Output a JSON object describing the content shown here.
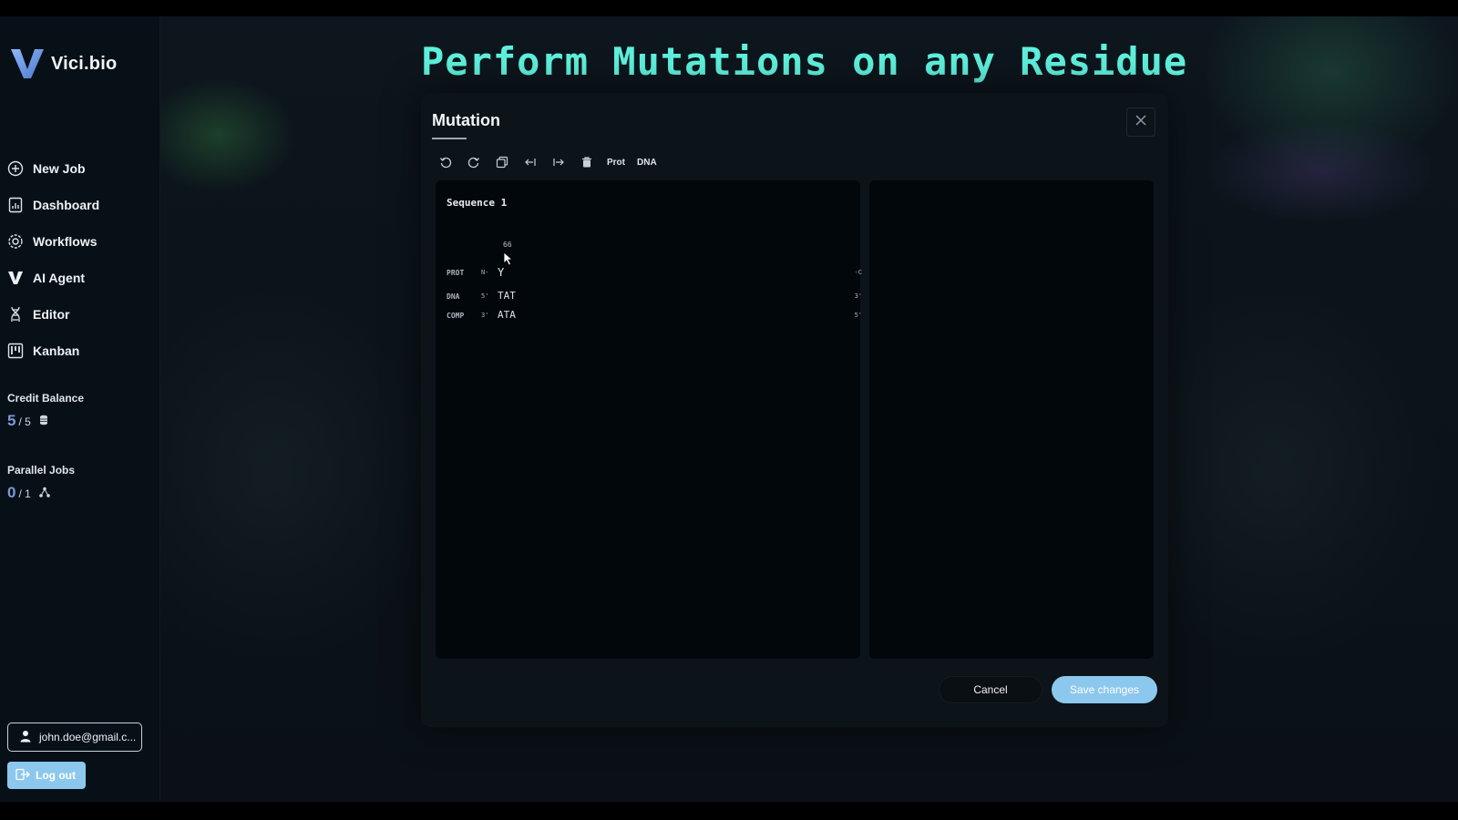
{
  "brand": {
    "name": "Vici.bio",
    "logo_icon": "v-logo-icon"
  },
  "headline": "Perform Mutations on any Residue",
  "sidebar": {
    "items": [
      {
        "label": "New Job",
        "icon": "plus-circle-icon"
      },
      {
        "label": "Dashboard",
        "icon": "chart-doc-icon"
      },
      {
        "label": "Workflows",
        "icon": "workflow-gear-icon"
      },
      {
        "label": "AI Agent",
        "icon": "v-agent-icon"
      },
      {
        "label": "Editor",
        "icon": "dna-helix-icon"
      },
      {
        "label": "Kanban",
        "icon": "kanban-board-icon"
      }
    ],
    "credit": {
      "label": "Credit Balance",
      "value": "5",
      "total": "/ 5",
      "icon": "coin-stack-icon"
    },
    "parallel": {
      "label": "Parallel Jobs",
      "value": "0",
      "total": "/ 1",
      "icon": "network-icon"
    },
    "user_email": "john.doe@gmail.c...",
    "logout_label": "Log out"
  },
  "modal": {
    "title": "Mutation",
    "toolbar": {
      "icons": [
        "undo-icon",
        "redo-icon",
        "copy-icon",
        "insert-left-icon",
        "insert-right-icon",
        "trash-icon"
      ],
      "prot_label": "Prot",
      "dna_label": "DNA"
    },
    "sequence": {
      "title": "Sequence 1",
      "position": "66",
      "rows": [
        {
          "label": "PROT",
          "start": "N-",
          "residues": "Y",
          "end": "-C"
        },
        {
          "label": "DNA",
          "start": "5'",
          "residues": "TAT",
          "end": "3'"
        },
        {
          "label": "COMP",
          "start": "3'",
          "residues": "ATA",
          "end": "5'"
        }
      ]
    },
    "cancel_label": "Cancel",
    "save_label": "Save changes"
  },
  "colors": {
    "accent": "#5ef0dc",
    "primary_button": "#8cc8ee",
    "stat_number": "#7a9ad8"
  }
}
